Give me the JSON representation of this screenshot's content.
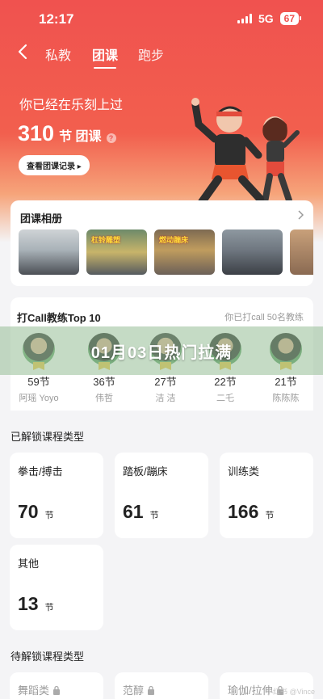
{
  "status": {
    "time": "12:17",
    "network": "5G",
    "battery": "67"
  },
  "nav": {
    "tabs": [
      "私教",
      "团课",
      "跑步"
    ],
    "active_tab": "团课"
  },
  "hero": {
    "line1": "你已经在乐刻上过",
    "count": "310",
    "unit": "节 团课",
    "record_button": "查看团课记录 ▸"
  },
  "album": {
    "title": "团课相册",
    "photos": [
      {
        "caption": ""
      },
      {
        "caption": "杠铃雕塑"
      },
      {
        "caption": "燃动蹦床"
      },
      {
        "caption": ""
      },
      {
        "caption": ""
      }
    ]
  },
  "coaches": {
    "title": "打Call教练Top 10",
    "subtitle": "你已打call 50名教练",
    "items": [
      {
        "count": "59节",
        "name": "阿瑶 Yoyo"
      },
      {
        "count": "36节",
        "name": "伟哲"
      },
      {
        "count": "27节",
        "name": "洁 洁"
      },
      {
        "count": "22节",
        "name": "二乇"
      },
      {
        "count": "21节",
        "name": "陈陈陈"
      }
    ]
  },
  "overlay": {
    "text": "01月03日热门拉满"
  },
  "unlocked": {
    "title": "已解锁课程类型",
    "types": [
      {
        "name": "拳击/搏击",
        "count": "70",
        "unit": "节"
      },
      {
        "name": "踏板/蹦床",
        "count": "61",
        "unit": "节"
      },
      {
        "name": "训练类",
        "count": "166",
        "unit": "节"
      },
      {
        "name": "其他",
        "count": "13",
        "unit": "节"
      }
    ]
  },
  "locked": {
    "title": "待解锁课程类型",
    "types": [
      {
        "name": "舞蹈类"
      },
      {
        "name": "范醇"
      },
      {
        "name": "瑜伽/拉伸"
      }
    ]
  },
  "watermark": "小红书 @Vince"
}
